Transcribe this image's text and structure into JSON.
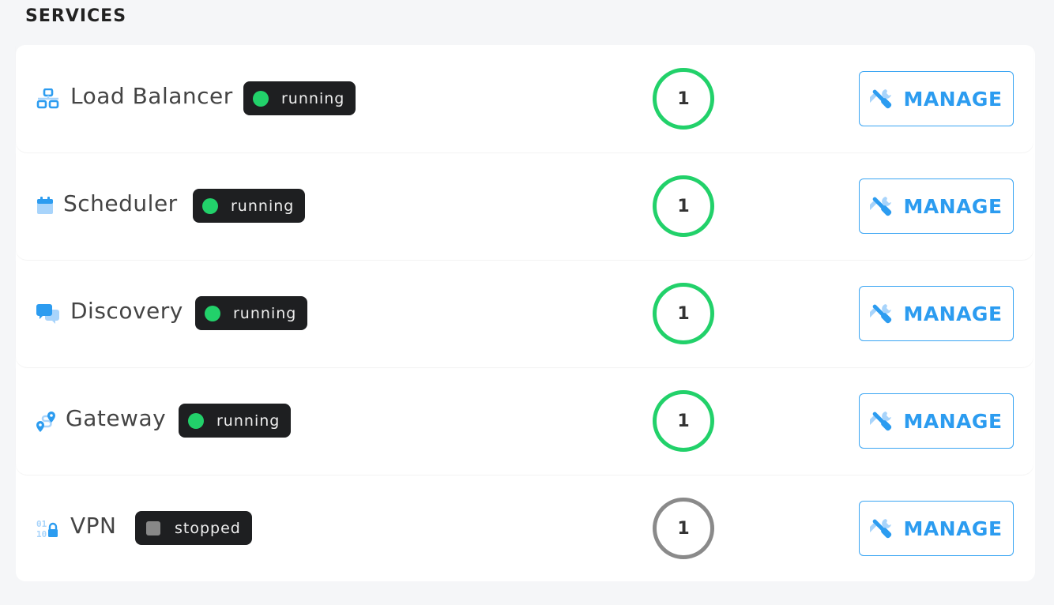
{
  "section": {
    "title": "SERVICES"
  },
  "colors": {
    "running": "#22d16a",
    "stopped": "#8a8a8a",
    "accent": "#2c9cf0",
    "badge_bg": "#1e1f21"
  },
  "services": [
    {
      "name": "Load Balancer",
      "icon": "network-icon",
      "status": "running",
      "count": "1",
      "action_label": "MANAGE",
      "action_icon": "tools-icon"
    },
    {
      "name": "Scheduler",
      "icon": "calendar-icon",
      "status": "running",
      "count": "1",
      "action_label": "MANAGE",
      "action_icon": "tools-icon"
    },
    {
      "name": "Discovery",
      "icon": "chat-bubbles-icon",
      "status": "running",
      "count": "1",
      "action_label": "MANAGE",
      "action_icon": "tools-icon"
    },
    {
      "name": "Gateway",
      "icon": "route-icon",
      "status": "running",
      "count": "1",
      "action_label": "MANAGE",
      "action_icon": "tools-icon"
    },
    {
      "name": "VPN",
      "icon": "binary-lock-icon",
      "status": "stopped",
      "count": "1",
      "action_label": "MANAGE",
      "action_icon": "tools-icon"
    }
  ]
}
